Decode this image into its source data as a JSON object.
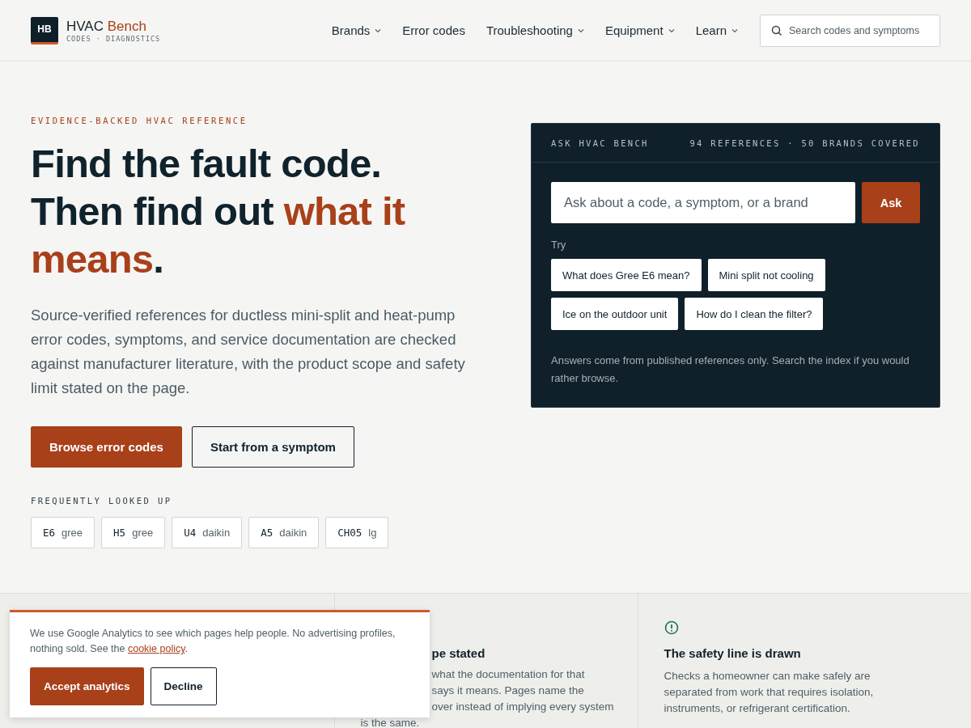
{
  "logo": {
    "mark": "HB",
    "name": "HVAC",
    "name_accent": "Bench",
    "tagline": "CODES · DIAGNOSTICS"
  },
  "nav": [
    {
      "label": "Brands",
      "dropdown": true
    },
    {
      "label": "Error codes",
      "dropdown": false
    },
    {
      "label": "Troubleshooting",
      "dropdown": true
    },
    {
      "label": "Equipment",
      "dropdown": true
    },
    {
      "label": "Learn",
      "dropdown": true
    }
  ],
  "search": {
    "placeholder": "Search codes and symptoms"
  },
  "hero": {
    "eyebrow": "EVIDENCE-BACKED HVAC REFERENCE",
    "headline": [
      {
        "text": "Find the fault code. Then find out ",
        "accent": false
      },
      {
        "text": "what it means",
        "accent": true
      },
      {
        "text": ".",
        "accent": false
      }
    ],
    "lead": "Source-verified references for ductless mini-split and heat-pump error codes, symptoms, and service documentation are checked against manufacturer literature, with the product scope and safety limit stated on the page.",
    "buttons": [
      {
        "label": "Browse error codes",
        "kind": "primary"
      },
      {
        "label": "Start from a symptom",
        "kind": "outline"
      }
    ],
    "frequent_label": "FREQUENTLY LOOKED UP",
    "frequent": [
      {
        "code": "E6",
        "brand": "gree"
      },
      {
        "code": "H5",
        "brand": "gree"
      },
      {
        "code": "U4",
        "brand": "daikin"
      },
      {
        "code": "A5",
        "brand": "daikin"
      },
      {
        "code": "CH05",
        "brand": "lg"
      }
    ]
  },
  "ask": {
    "title": "ASK HVAC BENCH",
    "stats": "94 REFERENCES · 50 BRANDS COVERED",
    "placeholder": "Ask about a code, a symptom, or a brand",
    "button": "Ask",
    "try_label": "Try",
    "suggestions": [
      "What does Gree E6 mean?",
      "Mini split not cooling",
      "Ice on the outdoor unit",
      "How do I clean the filter?"
    ],
    "note": "Answers come from published references only. Search the index if you would rather browse."
  },
  "features": [
    {
      "kind": "covered",
      "title": "pe stated",
      "lines": [
        {
          "text": "what the documentation for that",
          "partial": true
        },
        {
          "text": "says it means. Pages name the",
          "partial": true
        },
        {
          "text": "over instead of implying every system",
          "partial": true
        },
        {
          "text": "is the same.",
          "partial": false
        }
      ]
    },
    {
      "kind": "full",
      "title": "The safety line is drawn",
      "body": "Checks a homeowner can make safely are separated from work that requires isolation, instruments, or refrigerant certification."
    }
  ],
  "cookie": {
    "text": "We use Google Analytics to see which pages help people. No advertising profiles, nothing sold. See the ",
    "link": "cookie policy",
    "end": ".",
    "buttons": [
      {
        "label": "Accept analytics",
        "kind": "primary"
      },
      {
        "label": "Decline",
        "kind": "outline"
      }
    ]
  }
}
